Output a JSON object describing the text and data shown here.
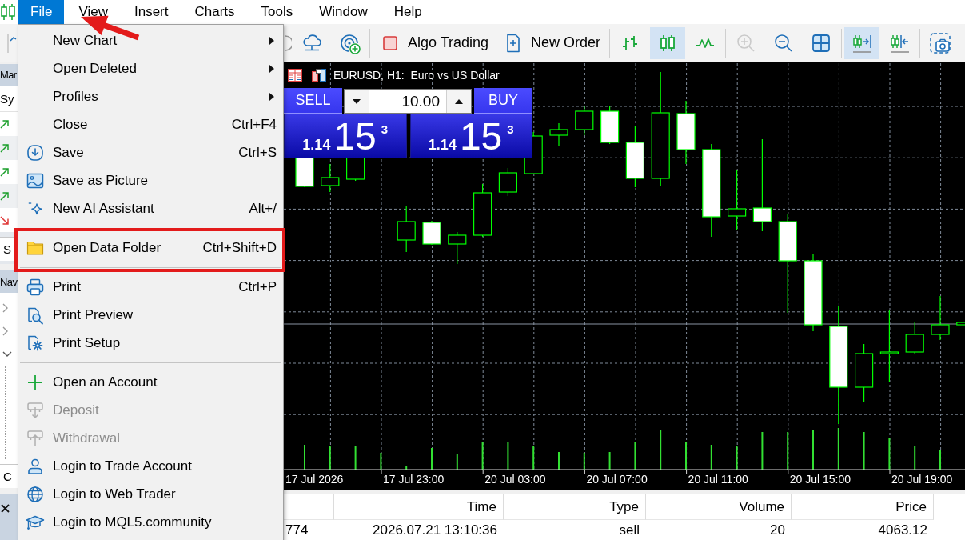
{
  "menu_bar": {
    "items": [
      {
        "label": "File",
        "selected": true
      },
      {
        "label": "View",
        "selected": false
      },
      {
        "label": "Insert",
        "selected": false
      },
      {
        "label": "Charts",
        "selected": false
      },
      {
        "label": "Tools",
        "selected": false
      },
      {
        "label": "Window",
        "selected": false
      },
      {
        "label": "Help",
        "selected": false
      }
    ]
  },
  "toolbar": {
    "items": [
      {
        "kind": "icon",
        "selected": false,
        "disabled": false
      },
      {
        "kind": "icon",
        "selected": false,
        "disabled": false
      },
      {
        "kind": "icon",
        "selected": false,
        "disabled": false
      },
      {
        "kind": "icon",
        "selected": false,
        "disabled": false
      },
      {
        "kind": "separator"
      },
      {
        "kind": "button",
        "label": "Algo Trading",
        "selected": false,
        "disabled": false
      },
      {
        "kind": "button",
        "label": "New Order",
        "selected": false,
        "disabled": false
      },
      {
        "kind": "separator"
      },
      {
        "kind": "icon",
        "selected": false,
        "disabled": false
      },
      {
        "kind": "icon",
        "selected": true,
        "disabled": false
      },
      {
        "kind": "icon",
        "selected": false,
        "disabled": false
      },
      {
        "kind": "separator"
      },
      {
        "kind": "icon",
        "selected": false,
        "disabled": true
      },
      {
        "kind": "icon",
        "selected": false,
        "disabled": false
      },
      {
        "kind": "icon",
        "selected": false,
        "disabled": false
      },
      {
        "kind": "separator"
      },
      {
        "kind": "icon",
        "selected": true,
        "disabled": false
      },
      {
        "kind": "icon",
        "selected": false,
        "disabled": false
      },
      {
        "kind": "separator"
      },
      {
        "kind": "icon",
        "selected": false,
        "disabled": false
      }
    ]
  },
  "market_watch": {
    "title": "Mar",
    "header": "Sy",
    "rows": [
      {
        "rising": true
      },
      {
        "rising": true
      },
      {
        "rising": true
      },
      {
        "rising": true
      },
      {
        "rising": false
      }
    ],
    "tabs": [
      {
        "label": "S",
        "selected": true
      }
    ]
  },
  "navigator": {
    "title": "Nav",
    "items": [
      {
        "expanded": false
      },
      {
        "expanded": false
      },
      {
        "expanded": true
      }
    ],
    "tabs": [
      {
        "label": "C",
        "selected": true
      }
    ]
  },
  "chart": {
    "title": "EURUSD, H1:  Euro vs US Dollar",
    "time_labels": [
      "17 Jul 2026",
      "17 Jul 23:00",
      "20 Jul 03:00",
      "20 Jul 07:00",
      "20 Jul 11:00",
      "20 Jul 15:00",
      "20 Jul 19:00"
    ]
  },
  "trade_panel": {
    "sell_label": "SELL",
    "buy_label": "BUY",
    "volume": "10.00",
    "sell_price": {
      "figure": "1.14",
      "pips": "15",
      "point": "3"
    },
    "buy_price": {
      "figure": "1.14",
      "pips": "15",
      "point": "3"
    }
  },
  "file_menu": {
    "items": [
      {
        "kind": "item",
        "label": "New Chart",
        "submenu": true,
        "disabled": false,
        "highlighted": false
      },
      {
        "kind": "item",
        "label": "Open Deleted",
        "submenu": true,
        "disabled": false,
        "highlighted": false
      },
      {
        "kind": "item",
        "label": "Profiles",
        "submenu": true,
        "disabled": false,
        "highlighted": false
      },
      {
        "kind": "item",
        "label": "Close",
        "shortcut": "Ctrl+F4",
        "submenu": false,
        "disabled": false,
        "highlighted": false
      },
      {
        "kind": "item",
        "label": "Save",
        "shortcut": "Ctrl+S",
        "submenu": false,
        "disabled": false,
        "highlighted": false
      },
      {
        "kind": "item",
        "label": "Save as Picture",
        "submenu": false,
        "disabled": false,
        "highlighted": false
      },
      {
        "kind": "item",
        "label": "New AI Assistant",
        "shortcut": "Alt+/",
        "submenu": false,
        "disabled": false,
        "highlighted": false
      },
      {
        "kind": "separator"
      },
      {
        "kind": "item",
        "label": "Open Data Folder",
        "shortcut": "Ctrl+Shift+D",
        "submenu": false,
        "disabled": false,
        "highlighted": true
      },
      {
        "kind": "separator"
      },
      {
        "kind": "item",
        "label": "Print",
        "shortcut": "Ctrl+P",
        "submenu": false,
        "disabled": false,
        "highlighted": false
      },
      {
        "kind": "item",
        "label": "Print Preview",
        "submenu": false,
        "disabled": false,
        "highlighted": false
      },
      {
        "kind": "item",
        "label": "Print Setup",
        "submenu": false,
        "disabled": false,
        "highlighted": false
      },
      {
        "kind": "separator"
      },
      {
        "kind": "item",
        "label": "Open an Account",
        "submenu": false,
        "disabled": false,
        "highlighted": false
      },
      {
        "kind": "item",
        "label": "Deposit",
        "submenu": false,
        "disabled": true,
        "highlighted": false
      },
      {
        "kind": "item",
        "label": "Withdrawal",
        "submenu": false,
        "disabled": true,
        "highlighted": false
      },
      {
        "kind": "item",
        "label": "Login to Trade Account",
        "submenu": false,
        "disabled": false,
        "highlighted": false
      },
      {
        "kind": "item",
        "label": "Login to Web Trader",
        "submenu": false,
        "disabled": false,
        "highlighted": false
      },
      {
        "kind": "item",
        "label": "Login to MQL5.community",
        "submenu": false,
        "disabled": false,
        "highlighted": false
      }
    ]
  },
  "toolbox": {
    "columns": [
      "",
      "Time",
      "Type",
      "Volume",
      "Price"
    ],
    "rows": [
      [
        "774",
        "2026.07.21 13:10:36",
        "sell",
        "20",
        "4063.12"
      ]
    ]
  }
}
